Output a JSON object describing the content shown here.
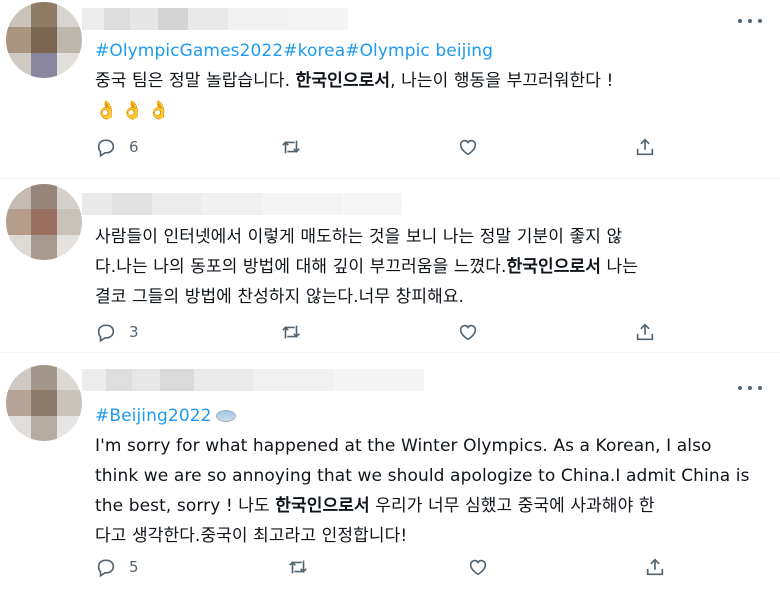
{
  "tweets": [
    {
      "hashtag_line": "#OlympicGames2022#korea#Olympic beijing",
      "lines": [
        {
          "pre": "중국 팀은 정말 놀랍습니다. ",
          "bold": "한국인으로서",
          "post": ", 나는이 행동을 부끄러워한다 !"
        }
      ],
      "emoji": "👌👌👌",
      "replies": "6",
      "retweets": "",
      "likes": ""
    },
    {
      "lines": [
        {
          "pre": "사람들이 인터넷에서 이렇게 매도하는 것을 보니 나는 정말 기분이 좋지 않",
          "bold": "",
          "post": ""
        },
        {
          "pre": "다.나는 나의 동포의 방법에 대해 깊이 부끄러움을 느꼈다.",
          "bold": "한국인으로서",
          "post": " 나는"
        },
        {
          "pre": "결코 그들의 방법에 찬성하지 않는다.너무 창피해요.",
          "bold": "",
          "post": ""
        }
      ],
      "replies": "3",
      "retweets": "",
      "likes": ""
    },
    {
      "hashtag_line": "#Beijing2022",
      "lines": [
        {
          "pre": "I'm sorry for what happened at the Winter Olympics. As a Korean, I also",
          "bold": "",
          "post": ""
        },
        {
          "pre": "think we are so annoying that we should apologize to China.I admit China is",
          "bold": "",
          "post": ""
        },
        {
          "pre": "the best, sorry ! 나도 ",
          "bold": "한국인으로서",
          "post": " 우리가 너무 심했고 중국에 사과해야 한"
        },
        {
          "pre": "다고 생각한다.중국이 최고라고 인정합니다!",
          "bold": "",
          "post": ""
        }
      ],
      "replies": "5",
      "retweets": "",
      "likes": ""
    }
  ],
  "colors": {
    "accent": "#1d9bf0",
    "muted": "#536471",
    "divider": "#eff3f4"
  },
  "icons": [
    "reply-icon",
    "retweet-icon",
    "like-icon",
    "share-icon",
    "more-icon"
  ]
}
